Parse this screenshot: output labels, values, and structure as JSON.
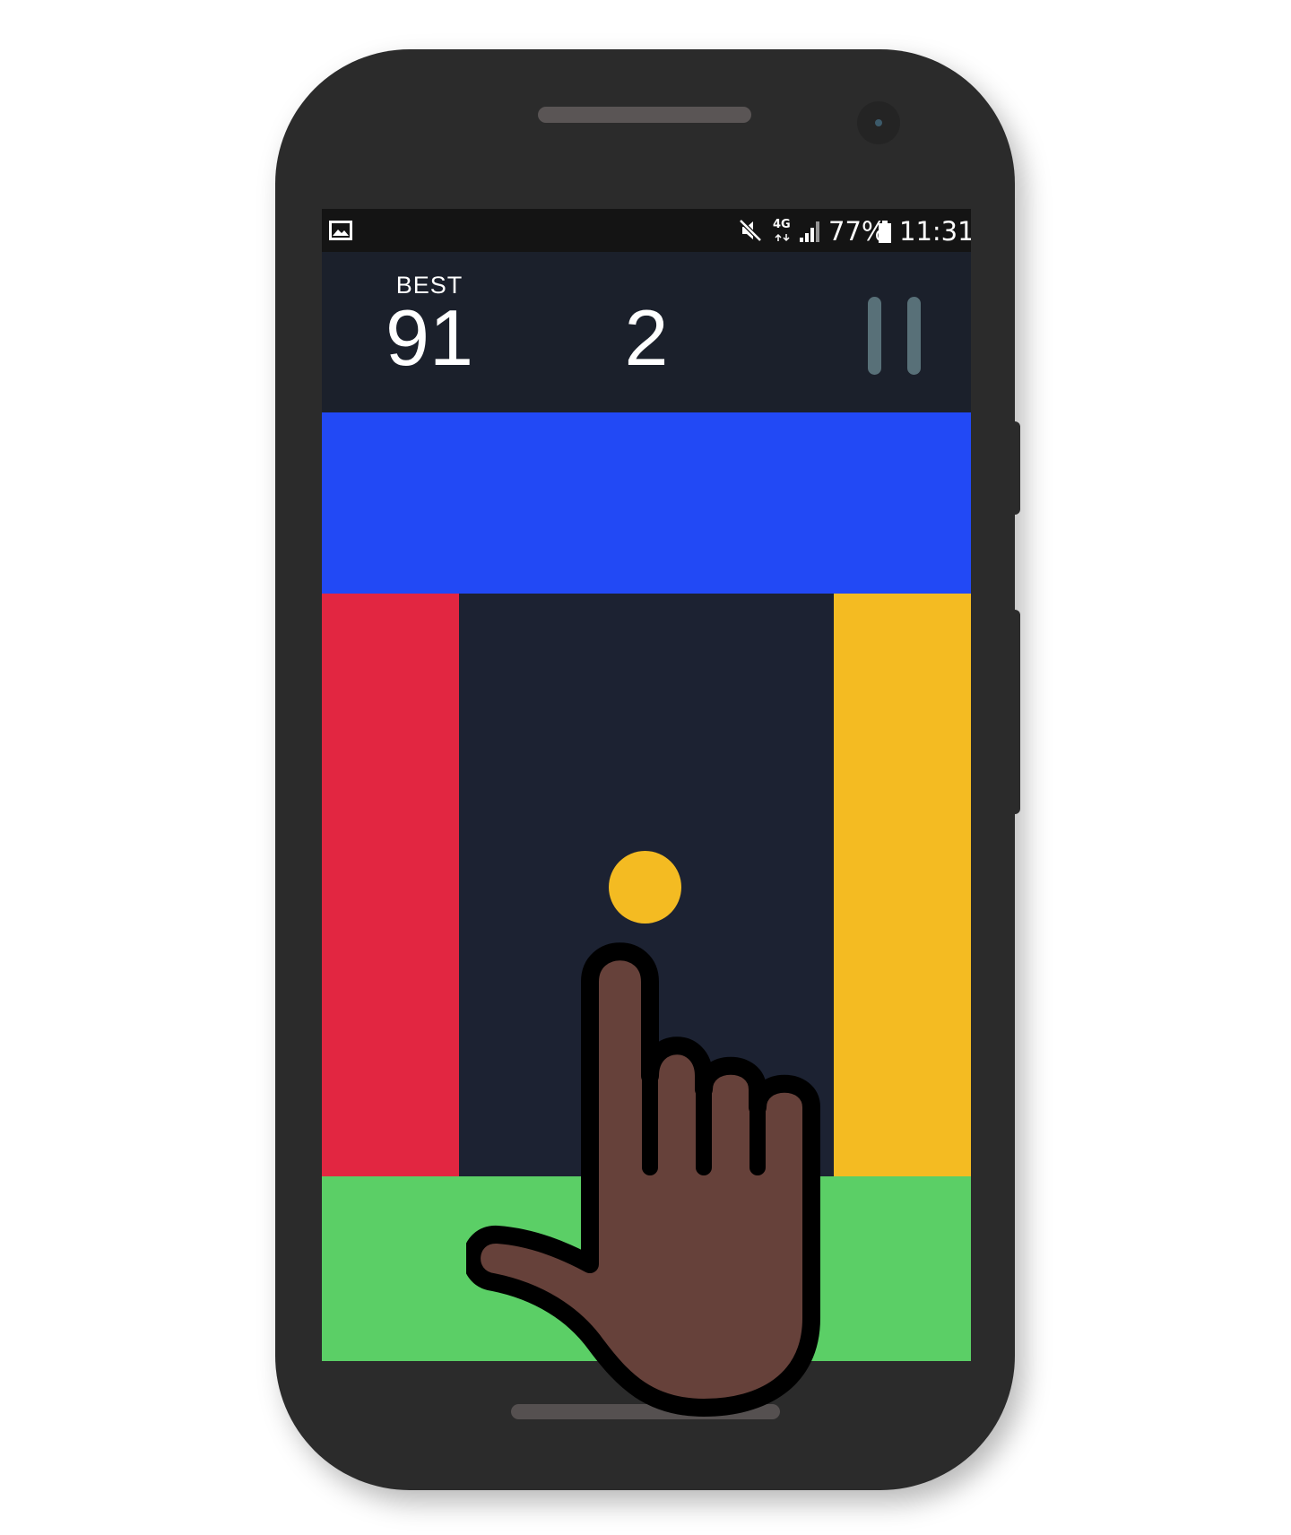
{
  "colors": {
    "phone_body": "#2b2b2b",
    "game_background": "#1c2232",
    "header_background": "#1b202b",
    "top_block": "#2249f5",
    "left_block": "#e22641",
    "right_block": "#f4bb22",
    "bottom_block": "#5bcf66",
    "ball": "#f4bb22",
    "pause_icon": "#587078",
    "hand_skin": "#66413a"
  },
  "status_bar": {
    "left_icon": "image-icon",
    "icons": [
      "mute-icon",
      "network-4g-icon",
      "signal-icon",
      "battery-icon"
    ],
    "network_label": "4G",
    "battery_percent": "77%",
    "time": "11:31"
  },
  "game": {
    "best_label": "BEST",
    "best_score": "91",
    "current_score": "2",
    "pause_icon": "pause-icon",
    "blocks": [
      "top-blue",
      "left-red",
      "right-yellow",
      "bottom-green"
    ],
    "ball_color": "yellow",
    "tutorial_icon": "tap-hand-icon"
  }
}
